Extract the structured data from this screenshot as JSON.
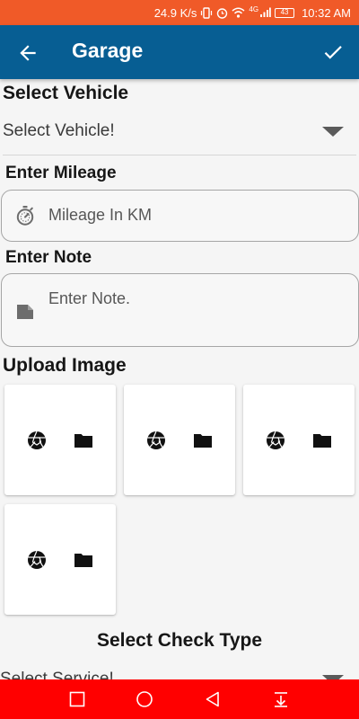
{
  "status_bar": {
    "speed": "24.9 K/s",
    "network": "4G",
    "battery": "43",
    "time": "10:32 AM"
  },
  "app_bar": {
    "title": "Garage"
  },
  "vehicle": {
    "heading": "Select Vehicle",
    "placeholder": "Select Vehicle!"
  },
  "mileage": {
    "heading": "Enter Mileage",
    "placeholder": "Mileage In KM"
  },
  "note": {
    "heading": "Enter Note",
    "placeholder": "Enter Note."
  },
  "upload": {
    "heading": "Upload Image",
    "slots": [
      {
        "icons": [
          "camera-icon",
          "folder-icon"
        ]
      },
      {
        "icons": [
          "camera-icon",
          "folder-icon"
        ]
      },
      {
        "icons": [
          "camera-icon",
          "folder-icon"
        ]
      },
      {
        "icons": [
          "camera-icon",
          "folder-icon"
        ]
      }
    ]
  },
  "check_type": {
    "heading": "Select Check Type",
    "placeholder": "Select Service!"
  },
  "colors": {
    "status_bar": "#f05a28",
    "app_bar": "#075e93",
    "nav_bar": "#ff0000",
    "background": "#f5f5f5"
  }
}
